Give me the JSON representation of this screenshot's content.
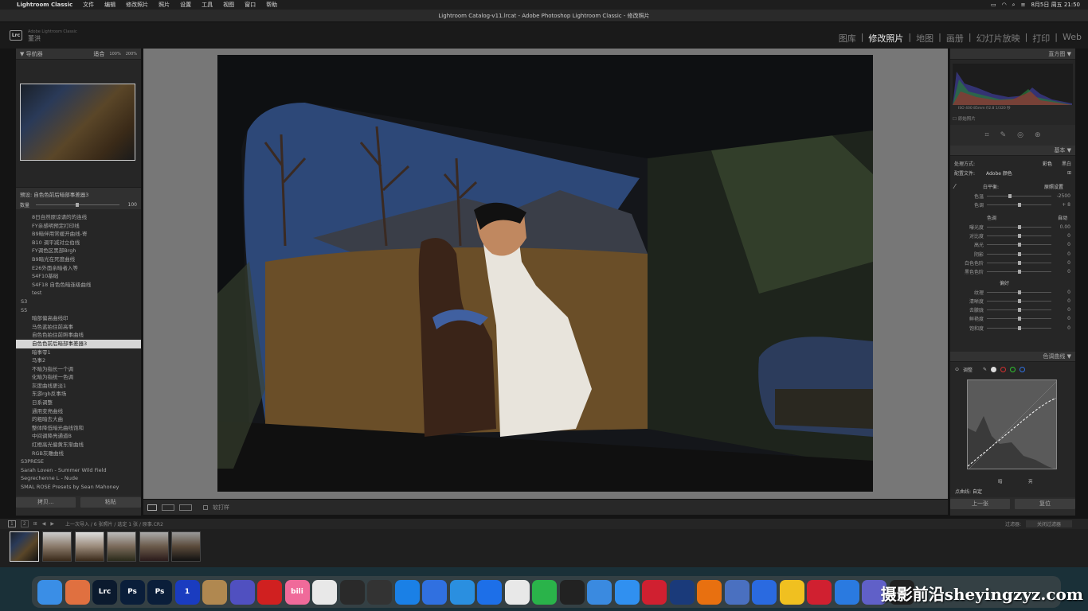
{
  "menubar": {
    "apple": "",
    "app": "Lightroom Classic",
    "items": [
      "文件",
      "编辑",
      "修改照片",
      "照片",
      "设置",
      "工具",
      "视图",
      "窗口",
      "帮助"
    ],
    "clock": "8月5日 周五 21:50"
  },
  "window_title": "Lightroom Catalog-v11.lrcat - Adobe Photoshop Lightroom Classic - 修改照片",
  "identity": {
    "logo": "Lrc",
    "line1": "Adobe Lightroom Classic",
    "line2": "董洪"
  },
  "modules": [
    "图库",
    "修改照片",
    "地图",
    "画册",
    "幻灯片放映",
    "打印",
    "Web"
  ],
  "active_module": "修改照片",
  "left": {
    "navigator": {
      "title": "导航器",
      "zoom": [
        "适合",
        "100%",
        "200%"
      ]
    },
    "preset_info": {
      "preset": "预设: 自色色前后暗部事差器3",
      "amount_label": "数量",
      "amount_value": "100",
      "amount_level": 1.0
    },
    "rows": [
      {
        "t": "8日自然原谅请的的连线",
        "g": false,
        "s": false
      },
      {
        "t": "FY亲感明预定打印线",
        "g": false,
        "s": false
      },
      {
        "t": "B9暗伴用常缓开曲线-寄",
        "g": false,
        "s": false
      },
      {
        "t": "B10 调平减对立伯线",
        "g": false,
        "s": false
      },
      {
        "t": "FY调色区黑部Brgh",
        "g": false,
        "s": false
      },
      {
        "t": "B9暗光在死度曲线",
        "g": false,
        "s": false
      },
      {
        "t": "E26外面亲暗者入等",
        "g": false,
        "s": false
      },
      {
        "t": "S4F10基础",
        "g": false,
        "s": false
      },
      {
        "t": "S4F18 自色色暗连级曲线",
        "g": false,
        "s": false
      },
      {
        "t": "test",
        "g": false,
        "s": false
      },
      {
        "t": "S3",
        "g": true,
        "s": false
      },
      {
        "t": "S5",
        "g": true,
        "s": false
      },
      {
        "t": "暗部偏高曲线印",
        "g": false,
        "s": false
      },
      {
        "t": "马色蓝拍住前高事",
        "g": false,
        "s": false
      },
      {
        "t": "自色色拍住前照事曲线",
        "g": false,
        "s": false
      },
      {
        "t": "自色色前后暗部事差器3",
        "g": false,
        "s": true
      },
      {
        "t": "暗事零1",
        "g": false,
        "s": false
      },
      {
        "t": "马事2",
        "g": false,
        "s": false
      },
      {
        "t": "不暗为指长一个调",
        "g": false,
        "s": false
      },
      {
        "t": "化暗为指统一色调",
        "g": false,
        "s": false
      },
      {
        "t": "灰度曲线更淡1",
        "g": false,
        "s": false
      },
      {
        "t": "东游rgb反事场",
        "g": false,
        "s": false
      },
      {
        "t": "日系调整",
        "g": false,
        "s": false
      },
      {
        "t": "通用变亮曲线",
        "g": false,
        "s": false
      },
      {
        "t": "的粗暗去大曲",
        "g": false,
        "s": false
      },
      {
        "t": "整体降低暗光曲线饱和",
        "g": false,
        "s": false
      },
      {
        "t": "中间调降亮通道B",
        "g": false,
        "s": false
      },
      {
        "t": "红橙高光偏黄东渐曲线",
        "g": false,
        "s": false
      },
      {
        "t": "RGB灰雕曲线",
        "g": false,
        "s": false
      },
      {
        "t": "S3PRESE",
        "g": true,
        "s": false
      },
      {
        "t": "Sarah Loven - Summer Wild Field",
        "g": true,
        "s": false
      },
      {
        "t": "Segrechenne L - Nude",
        "g": true,
        "s": false
      },
      {
        "t": "SMAL ROSE Presets by Sean Mahoney",
        "g": true,
        "s": false
      }
    ],
    "copy_button": "拷贝...",
    "paste_button": "粘贴"
  },
  "toolbar": {
    "softproof": "软打样"
  },
  "right": {
    "histogram": {
      "title": "直方图",
      "values": "ISO 400   85mm   f/2.8   1/320 秒",
      "original": "原始照片"
    },
    "basic": {
      "title": "基本",
      "treatment_label": "处理方式:",
      "treatment_color": "彩色",
      "treatment_bw": "黑白",
      "profile_label": "配置文件:",
      "profile_value": "Adobe 颜色",
      "wb_label": "白平衡:",
      "wb_value": "原照设置",
      "sliders1": [
        {
          "label": "色温",
          "value": "-2500",
          "level": 0.36
        },
        {
          "label": "色调",
          "value": "+ 8",
          "level": 0.51
        }
      ],
      "tone_label": "色调",
      "tone_auto": "自动",
      "sliders2": [
        {
          "label": "曝光度",
          "value": "0.00",
          "level": 0.5
        },
        {
          "label": "对比度",
          "value": "0",
          "level": 0.5
        },
        {
          "label": "高光",
          "value": "0",
          "level": 0.5
        },
        {
          "label": "阴影",
          "value": "0",
          "level": 0.5
        },
        {
          "label": "白色色阶",
          "value": "0",
          "level": 0.5
        },
        {
          "label": "黑色色阶",
          "value": "0",
          "level": 0.5
        }
      ],
      "presence_label": "偏好",
      "sliders3": [
        {
          "label": "纹理",
          "value": "0",
          "level": 0.5
        },
        {
          "label": "清晰度",
          "value": "0",
          "level": 0.5
        },
        {
          "label": "去朦胧",
          "value": "0",
          "level": 0.5
        },
        {
          "label": "鲜艳度",
          "value": "0",
          "level": 0.5
        },
        {
          "label": "饱和度",
          "value": "0",
          "level": 0.5
        }
      ]
    },
    "tone_curve": {
      "title": "色调曲线",
      "adjust_label": "调整",
      "shadows_label": "暗",
      "lights_label": "亮",
      "channel_label": "点曲线:",
      "channel_value": "自定"
    },
    "prev_button": "上一张",
    "reset_button": "复位"
  },
  "filmstrip": {
    "info": "上一次导入 / 6 张照片 / 选定 1 张 / 原事.CR2",
    "filter_label": "过滤器:",
    "filter_value": "关闭过滤器"
  },
  "dock": [
    {
      "name": "finder",
      "t": "",
      "c": "#3a8ee6"
    },
    {
      "name": "launchpad",
      "t": "",
      "c": "#e07040"
    },
    {
      "name": "lightroom",
      "t": "Lrc",
      "c": "#0b1a2e"
    },
    {
      "name": "photoshop",
      "t": "Ps",
      "c": "#0a1e3a"
    },
    {
      "name": "photoshop-beta",
      "t": "Ps",
      "c": "#0a1e3a"
    },
    {
      "name": "1password",
      "t": "1",
      "c": "#1a3cc0"
    },
    {
      "name": "archive",
      "t": "",
      "c": "#b08850"
    },
    {
      "name": "creative",
      "t": "",
      "c": "#5050c0"
    },
    {
      "name": "record",
      "t": "",
      "c": "#d02020"
    },
    {
      "name": "bilibili",
      "t": "bili",
      "c": "#f06a9a"
    },
    {
      "name": "dolphin",
      "t": "",
      "c": "#e8e8e8"
    },
    {
      "name": "davinci",
      "t": "",
      "c": "#2a2a2a"
    },
    {
      "name": "finalcut",
      "t": "",
      "c": "#333"
    },
    {
      "name": "safari",
      "t": "",
      "c": "#1a80e6"
    },
    {
      "name": "mail",
      "t": "",
      "c": "#3070e0"
    },
    {
      "name": "maps",
      "t": "",
      "c": "#2a8fe0"
    },
    {
      "name": "link",
      "t": "",
      "c": "#1d6fe8"
    },
    {
      "name": "chrome",
      "t": "",
      "c": "#e8e8e8"
    },
    {
      "name": "wechat",
      "t": "",
      "c": "#2ab34a"
    },
    {
      "name": "qq",
      "t": "",
      "c": "#222"
    },
    {
      "name": "bird",
      "t": "",
      "c": "#3a8ae0"
    },
    {
      "name": "network",
      "t": "",
      "c": "#3090f0"
    },
    {
      "name": "red",
      "t": "",
      "c": "#d02030"
    },
    {
      "name": "video",
      "t": "",
      "c": "#1a3a7a"
    },
    {
      "name": "vlc",
      "t": "",
      "c": "#e87010"
    },
    {
      "name": "share",
      "t": "",
      "c": "#4a70c0"
    },
    {
      "name": "feishu",
      "t": "",
      "c": "#2a6ae0"
    },
    {
      "name": "wechat2",
      "t": "",
      "c": "#f0c020"
    },
    {
      "name": "netease",
      "t": "",
      "c": "#d02030"
    },
    {
      "name": "plane",
      "t": "",
      "c": "#2a7ae0"
    },
    {
      "name": "game",
      "t": "",
      "c": "#6060c8"
    },
    {
      "name": "alarm",
      "t": "",
      "c": "#202020"
    }
  ],
  "watermark": "摄影前沿sheyingzyz.com"
}
